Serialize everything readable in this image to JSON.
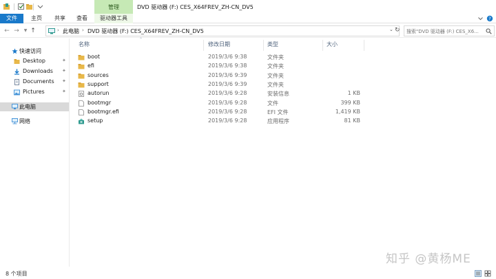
{
  "titlebar": {
    "context_tab": "管理",
    "window_title": "DVD 驱动器 (F:) CES_X64FREV_ZH-CN_DV5"
  },
  "ribbon": {
    "tabs": [
      "文件",
      "主页",
      "共享",
      "查看",
      "驱动器工具"
    ]
  },
  "nav": {
    "back_icon": "back-arrow-icon",
    "forward_icon": "forward-arrow-icon",
    "recent_icon": "chevron-down-icon",
    "up_icon": "up-arrow-icon"
  },
  "address": {
    "segments": [
      "此电脑",
      "DVD 驱动器 (F:) CES_X64FREV_ZH-CN_DV5"
    ],
    "search_placeholder": "搜索\"DVD 驱动器 (F:) CES_X6..."
  },
  "sidebar": {
    "items": [
      {
        "label": "快速访问",
        "icon": "star-icon"
      },
      {
        "label": "Desktop",
        "icon": "folder-icon"
      },
      {
        "label": "Downloads",
        "icon": "download-icon"
      },
      {
        "label": "Documents",
        "icon": "documents-icon"
      },
      {
        "label": "Pictures",
        "icon": "pictures-icon"
      },
      {
        "label": "此电脑",
        "icon": "computer-icon"
      },
      {
        "label": "网络",
        "icon": "network-icon"
      }
    ]
  },
  "columns": {
    "name": "名称",
    "date": "修改日期",
    "type": "类型",
    "size": "大小"
  },
  "files": [
    {
      "name": "boot",
      "date": "2019/3/6 9:38",
      "type": "文件夹",
      "size": "",
      "icon": "folder-icon"
    },
    {
      "name": "efi",
      "date": "2019/3/6 9:38",
      "type": "文件夹",
      "size": "",
      "icon": "folder-icon"
    },
    {
      "name": "sources",
      "date": "2019/3/6 9:39",
      "type": "文件夹",
      "size": "",
      "icon": "folder-icon"
    },
    {
      "name": "support",
      "date": "2019/3/6 9:39",
      "type": "文件夹",
      "size": "",
      "icon": "folder-icon"
    },
    {
      "name": "autorun",
      "date": "2019/3/6 9:28",
      "type": "安装信息",
      "size": "1 KB",
      "icon": "settings-file-icon"
    },
    {
      "name": "bootmgr",
      "date": "2019/3/6 9:28",
      "type": "文件",
      "size": "399 KB",
      "icon": "file-icon"
    },
    {
      "name": "bootmgr.efi",
      "date": "2019/3/6 9:28",
      "type": "EFI 文件",
      "size": "1,419 KB",
      "icon": "file-icon"
    },
    {
      "name": "setup",
      "date": "2019/3/6 9:28",
      "type": "应用程序",
      "size": "81 KB",
      "icon": "setup-app-icon"
    }
  ],
  "status": {
    "item_count": "8 个项目"
  },
  "watermark": "知乎 @黄杨ME",
  "colors": {
    "file_tab": "#1979ca",
    "context_tab": "#c6e9b5",
    "folder": "#e8b84a",
    "selection": "#d9d9d9"
  }
}
